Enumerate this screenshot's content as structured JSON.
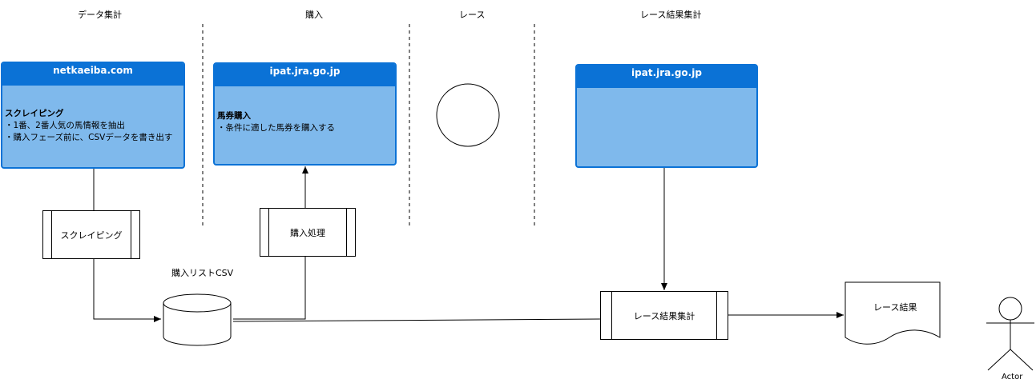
{
  "lanes": [
    {
      "title": "データ集計"
    },
    {
      "title": "購入"
    },
    {
      "title": "レース"
    },
    {
      "title": "レース結果集計"
    }
  ],
  "cards": [
    {
      "title": "netkaeiba.com",
      "heading": "スクレイピング",
      "lines": [
        "・1番、2番人気の馬情報を抽出",
        "・購入フェーズ前に、CSVデータを書き出す"
      ]
    },
    {
      "title": "ipat.jra.go.jp",
      "heading": "馬券購入",
      "lines": [
        "・条件に適した馬券を購入する"
      ]
    },
    {
      "title": "ipat.jra.go.jp",
      "heading": "",
      "lines": []
    }
  ],
  "processes": [
    {
      "label": "スクレイピング"
    },
    {
      "label": "購入処理"
    },
    {
      "label": "レース結果集計"
    }
  ],
  "storage": {
    "label": "購入リストCSV"
  },
  "document": {
    "label": "レース結果"
  },
  "actor": {
    "label": "Actor"
  }
}
